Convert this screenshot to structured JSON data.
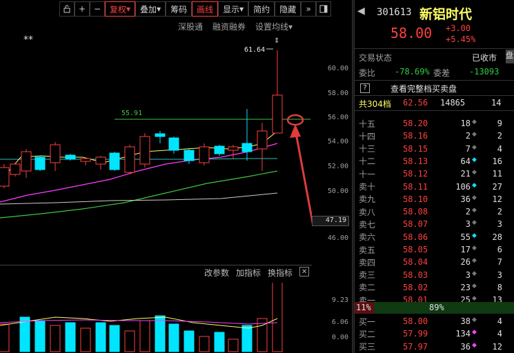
{
  "toolbar": {
    "buttons": [
      "复权",
      "叠加",
      "筹码",
      "画线",
      "显示",
      "简约",
      "隐藏"
    ],
    "more": "»"
  },
  "sublinks": [
    "深股通",
    "融资融券",
    "设置均线"
  ],
  "chart": {
    "markers": [
      "**"
    ],
    "high_label": "61.64",
    "ref_label": "55.91",
    "y_ticks": [
      "60.00",
      "58.00",
      "56.00",
      "54.00",
      "52.00",
      "50.00",
      "48.00",
      "46.00"
    ],
    "current_price_box": "47.19"
  },
  "volume": {
    "header": [
      "改参数",
      "加指标",
      "换指标"
    ],
    "y_ticks": [
      "9.23",
      "6.06",
      "3.08",
      "0.00"
    ],
    "unit": "万"
  },
  "colors": {
    "up": "#ff4040",
    "down": "#00e5ff",
    "annotation": "#e03c3c"
  },
  "stock": {
    "code": "301613",
    "name": "新铝时代",
    "price": "58.00",
    "change": "+3.00",
    "change_pct": "+5.45%"
  },
  "status": {
    "label": "交易状态",
    "value": "已收市"
  },
  "ratio": {
    "wb_label": "委比",
    "wb_value": "-78.69%",
    "wc_label": "委差",
    "wc_value": "-13093"
  },
  "full_book": {
    "help": "?",
    "label": "查看完整档买卖盘"
  },
  "total": {
    "label": "共304档",
    "price": "62.56",
    "vol": "14865",
    "count": "14"
  },
  "asks": [
    {
      "label": "十五",
      "price": "58.20",
      "vol": "18",
      "dot": "g",
      "n": "9"
    },
    {
      "label": "十四",
      "price": "58.16",
      "vol": "2",
      "dot": "g",
      "n": "2"
    },
    {
      "label": "十三",
      "price": "58.15",
      "vol": "7",
      "dot": "g",
      "n": "4"
    },
    {
      "label": "十二",
      "price": "58.13",
      "vol": "64",
      "dot": "c",
      "n": "16"
    },
    {
      "label": "十一",
      "price": "58.12",
      "vol": "21",
      "dot": "g",
      "n": "11"
    },
    {
      "label": "卖十",
      "price": "58.11",
      "vol": "106",
      "dot": "c",
      "n": "27"
    },
    {
      "label": "卖九",
      "price": "58.10",
      "vol": "36",
      "dot": "g",
      "n": "12"
    },
    {
      "label": "卖八",
      "price": "58.08",
      "vol": "2",
      "dot": "g",
      "n": "2"
    },
    {
      "label": "卖七",
      "price": "58.07",
      "vol": "3",
      "dot": "g",
      "n": "3"
    },
    {
      "label": "卖六",
      "price": "58.06",
      "vol": "55",
      "dot": "c",
      "n": "28"
    },
    {
      "label": "卖五",
      "price": "58.05",
      "vol": "17",
      "dot": "g",
      "n": "6"
    },
    {
      "label": "卖四",
      "price": "58.04",
      "vol": "26",
      "dot": "g",
      "n": "7"
    },
    {
      "label": "卖三",
      "price": "58.03",
      "vol": "3",
      "dot": "g",
      "n": "3"
    },
    {
      "label": "卖二",
      "price": "58.02",
      "vol": "23",
      "dot": "g",
      "n": "8"
    },
    {
      "label": "卖一",
      "price": "58.01",
      "vol": "25",
      "dot": "g",
      "n": "13"
    }
  ],
  "split": {
    "left": "11%",
    "right": "89%"
  },
  "bids": [
    {
      "label": "买一",
      "price": "58.00",
      "vol": "38",
      "dot": "g",
      "n": "4"
    },
    {
      "label": "买二",
      "price": "57.99",
      "vol": "134",
      "dot": "m",
      "n": "4"
    },
    {
      "label": "买三",
      "price": "57.97",
      "vol": "36",
      "dot": "m",
      "n": "12"
    }
  ],
  "side_tab": {
    "label": "盘"
  },
  "right_edge_chars": [
    "最",
    "涨",
    "总",
    "换",
    "净",
    "涨",
    "外",
    "总",
    "流",
    "涨",
    "收",
    "市",
    "股",
    "涨",
    "流"
  ]
}
